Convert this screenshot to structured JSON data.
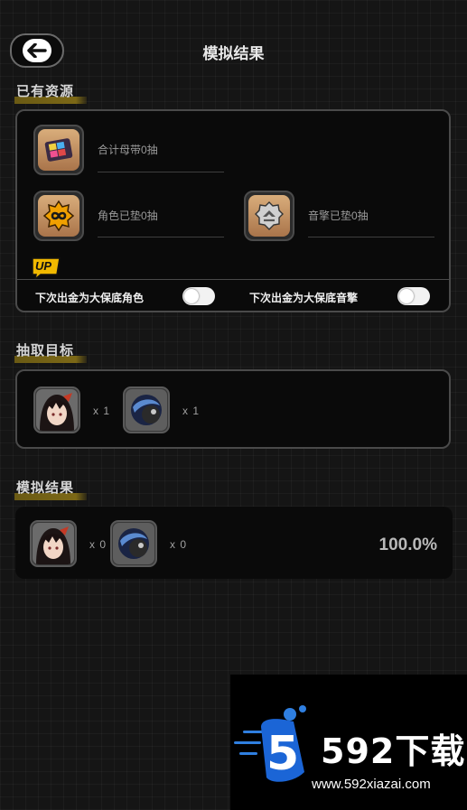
{
  "header": {
    "title": "模拟结果",
    "back_icon": "arrow-left-icon"
  },
  "resources": {
    "section_title": "已有资源",
    "items": [
      {
        "icon": "film-reel-icon",
        "label": "合计母带0抽"
      },
      {
        "icon": "infinity-badge-icon",
        "label": "角色已垫0抽"
      },
      {
        "icon": "gear-engine-icon",
        "label": "音擎已垫0抽"
      }
    ],
    "up_badge": "UP",
    "toggles": [
      {
        "label": "下次出金为大保底角色",
        "state": "off"
      },
      {
        "label": "下次出金为大保底音擎",
        "state": "off"
      }
    ]
  },
  "targets": {
    "section_title": "抽取目标",
    "items": [
      {
        "icon": "character-portrait-icon",
        "qty": "x 1"
      },
      {
        "icon": "engine-orb-icon",
        "qty": "x 1"
      }
    ]
  },
  "results": {
    "section_title": "模拟结果",
    "items": [
      {
        "icon": "character-portrait-icon",
        "qty": "x 0"
      },
      {
        "icon": "engine-orb-icon",
        "qty": "x 0"
      }
    ],
    "probability": "100.0%"
  },
  "watermark": {
    "logo": "5",
    "brand": "592下载",
    "url": "www.592xiazai.com"
  },
  "colors": {
    "accent_gold": "#7c6816",
    "panel_border": "#4a4a4a",
    "icon_bronze": "#b98455"
  }
}
